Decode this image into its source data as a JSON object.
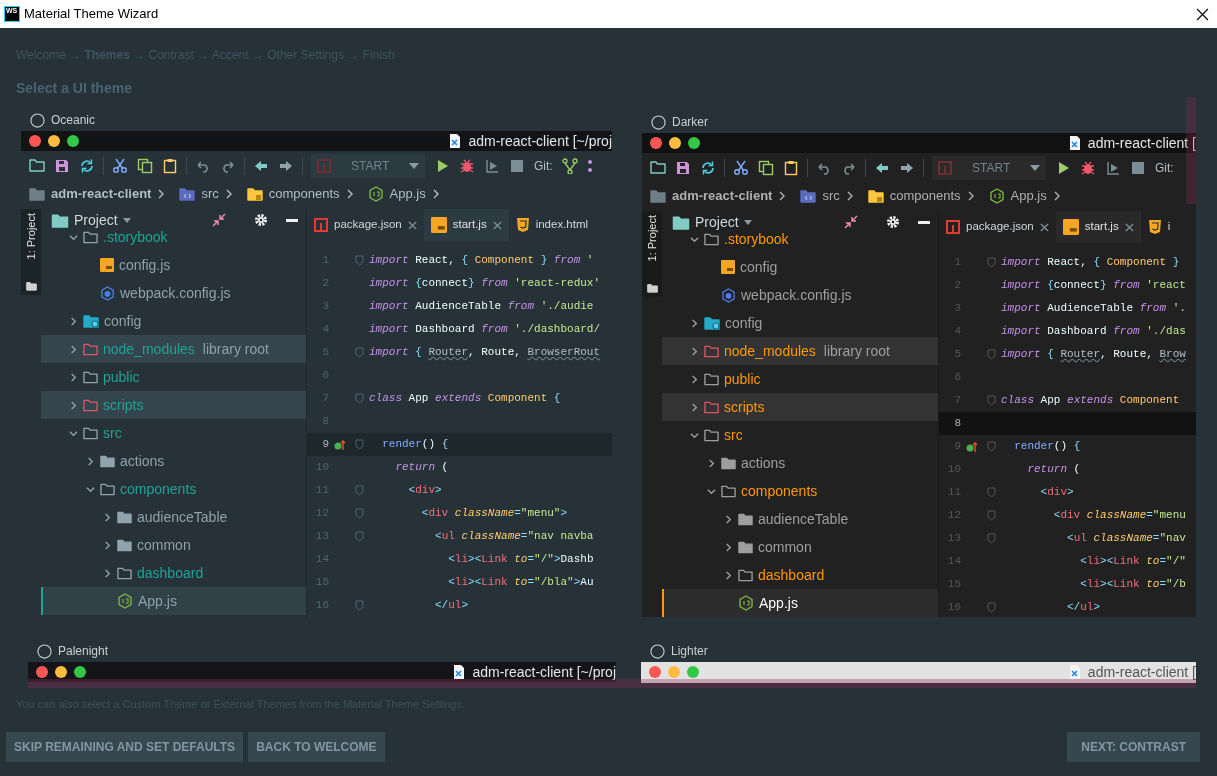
{
  "window": {
    "app_icon_text": "WS",
    "title": "Material Theme Wizard"
  },
  "steps": "Welcome → **Themes** → Contrast → Accent → Other Settings → Finish",
  "heading": "Select a UI theme",
  "themes": [
    {
      "name": "Oceanic",
      "selected": false,
      "kind": "oceanic",
      "preview": {
        "title": "adm-react-client [~/proj",
        "run_config": "START",
        "git_label": "Git:",
        "git_icons": true,
        "breadcrumbs": [
          {
            "label": "adm-react-client",
            "kind": "root"
          },
          {
            "label": "src",
            "kind": "source"
          },
          {
            "label": "components",
            "kind": "package"
          },
          {
            "label": "App.js",
            "kind": "node"
          }
        ],
        "side_tab": "1: Project",
        "panel_title": "Project",
        "tree": [
          {
            "label": ".storybook",
            "kind": "folder",
            "expanded": true,
            "accent": true,
            "highlighted": false,
            "selected": false,
            "children": [
              {
                "label": "config.js",
                "kind": "js",
                "accent": false,
                "highlighted": false,
                "selected": false
              },
              {
                "label": "webpack.config.js",
                "kind": "webpack",
                "accent": false,
                "highlighted": false,
                "selected": false
              }
            ]
          },
          {
            "label": "config",
            "kind": "config_folder",
            "expanded": false,
            "accent": false,
            "highlighted": false,
            "selected": false
          },
          {
            "label": "node_modules",
            "note": "library root",
            "kind": "excluded",
            "expanded": false,
            "accent": true,
            "highlighted": true,
            "selected": false
          },
          {
            "label": "public",
            "kind": "folder",
            "expanded": false,
            "accent": true,
            "highlighted": false,
            "selected": false
          },
          {
            "label": "scripts",
            "kind": "excluded",
            "expanded": false,
            "accent": true,
            "highlighted": true,
            "selected": false
          },
          {
            "label": "src",
            "kind": "folder",
            "expanded": true,
            "accent": true,
            "highlighted": false,
            "selected": false,
            "children": [
              {
                "label": "actions",
                "kind": "filled_folder",
                "expanded": false,
                "accent": false,
                "highlighted": false,
                "selected": false
              },
              {
                "label": "components",
                "kind": "folder",
                "expanded": true,
                "accent": true,
                "highlighted": false,
                "selected": false,
                "children": [
                  {
                    "label": "audienceTable",
                    "kind": "filled_folder",
                    "expanded": false,
                    "accent": false,
                    "highlighted": false,
                    "selected": false
                  },
                  {
                    "label": "common",
                    "kind": "filled_folder",
                    "expanded": false,
                    "accent": false,
                    "highlighted": false,
                    "selected": false
                  },
                  {
                    "label": "dashboard",
                    "kind": "folder",
                    "expanded": false,
                    "accent": true,
                    "highlighted": false,
                    "selected": false
                  },
                  {
                    "label": "App.js",
                    "kind": "node",
                    "accent": false,
                    "highlighted": false,
                    "selected": true
                  }
                ]
              }
            ]
          }
        ],
        "tabs": [
          {
            "label": "package.json",
            "kind": "npm",
            "selected": false,
            "closable": true
          },
          {
            "label": "start.js",
            "kind": "js",
            "selected": true,
            "closable": true
          },
          {
            "label": "index.html",
            "kind": "html",
            "selected": false,
            "closable": false
          }
        ],
        "code": [
          {
            "n": "1",
            "current": false,
            "mark": false,
            "fold": true,
            "code": [
              {
                "kind": "keyword",
                "text": "import"
              },
              {
                "text": " React, "
              },
              {
                "kind": "punct",
                "text": "{ "
              },
              {
                "kind": "class",
                "text": "Component"
              },
              {
                "kind": "punct",
                "text": " } "
              },
              {
                "kind": "keyword",
                "text": "from"
              },
              {
                "kind": "string",
                "text": " '"
              }
            ]
          },
          {
            "n": "2",
            "current": false,
            "mark": false,
            "fold": false,
            "code": [
              {
                "kind": "keyword",
                "text": "import"
              },
              {
                "kind": "punct",
                "text": " {"
              },
              {
                "text": "connect"
              },
              {
                "kind": "punct",
                "text": "} "
              },
              {
                "kind": "keyword",
                "text": "from"
              },
              {
                "kind": "string",
                "text": " 'react-redux'"
              }
            ]
          },
          {
            "n": "3",
            "current": false,
            "mark": false,
            "fold": false,
            "code": [
              {
                "kind": "keyword",
                "text": "import"
              },
              {
                "text": " AudienceTable "
              },
              {
                "kind": "keyword",
                "text": "from"
              },
              {
                "kind": "string",
                "text": " './audie"
              }
            ]
          },
          {
            "n": "4",
            "current": false,
            "mark": false,
            "fold": false,
            "code": [
              {
                "kind": "keyword",
                "text": "import"
              },
              {
                "text": " Dashboard "
              },
              {
                "kind": "keyword",
                "text": "from"
              },
              {
                "kind": "string",
                "text": " './dashboard/"
              }
            ]
          },
          {
            "n": "5",
            "current": false,
            "mark": false,
            "fold": true,
            "code": [
              {
                "kind": "keyword",
                "text": "import"
              },
              {
                "kind": "punct",
                "text": " { "
              },
              {
                "kind": "warning",
                "text": "Router"
              },
              {
                "text": ", Route, "
              },
              {
                "kind": "warning",
                "text": "BrowserRout"
              }
            ]
          },
          {
            "n": "6",
            "current": false,
            "mark": false,
            "fold": false
          },
          {
            "n": "7",
            "current": false,
            "mark": false,
            "fold": true,
            "code": [
              {
                "kind": "keyword",
                "text": "class"
              },
              {
                "text": " App "
              },
              {
                "kind": "keyword",
                "text": "extends"
              },
              {
                "kind": "class",
                "text": " Component"
              },
              {
                "kind": "punct",
                "text": " {"
              }
            ]
          },
          {
            "n": "8",
            "current": false,
            "mark": false,
            "fold": false
          },
          {
            "n": "9",
            "current": true,
            "mark": true,
            "fold": true,
            "code": [
              {
                "kind": "function",
                "text": "  render"
              },
              {
                "text": "() "
              },
              {
                "kind": "punct",
                "text": "{"
              }
            ]
          },
          {
            "n": "10",
            "current": false,
            "mark": false,
            "fold": false,
            "code": [
              {
                "kind": "keyword",
                "text": "    return"
              },
              {
                "text": " ("
              }
            ]
          },
          {
            "n": "11",
            "current": false,
            "mark": false,
            "fold": true,
            "code": [
              {
                "kind": "punct",
                "text": "      <"
              },
              {
                "kind": "tag",
                "text": "div"
              },
              {
                "kind": "punct",
                "text": ">"
              }
            ]
          },
          {
            "n": "12",
            "current": false,
            "mark": false,
            "fold": true,
            "code": [
              {
                "kind": "punct",
                "text": "        <"
              },
              {
                "kind": "tag",
                "text": "div"
              },
              {
                "kind": "attribute",
                "text": " className"
              },
              {
                "kind": "punct",
                "text": "="
              },
              {
                "kind": "string",
                "text": "\"menu\""
              },
              {
                "kind": "punct",
                "text": ">"
              }
            ]
          },
          {
            "n": "13",
            "current": false,
            "mark": false,
            "fold": true,
            "code": [
              {
                "kind": "punct",
                "text": "          <"
              },
              {
                "kind": "tag",
                "text": "ul"
              },
              {
                "kind": "attribute",
                "text": " className"
              },
              {
                "kind": "punct",
                "text": "="
              },
              {
                "kind": "string",
                "text": "\"nav navba"
              }
            ]
          },
          {
            "n": "14",
            "current": false,
            "mark": false,
            "fold": false,
            "code": [
              {
                "kind": "punct",
                "text": "            <"
              },
              {
                "kind": "tag",
                "text": "li"
              },
              {
                "kind": "punct",
                "text": "><"
              },
              {
                "kind": "tag",
                "text": "Link"
              },
              {
                "kind": "attribute",
                "text": " to"
              },
              {
                "kind": "punct",
                "text": "="
              },
              {
                "kind": "string",
                "text": "\"/\""
              },
              {
                "kind": "punct",
                "text": ">"
              },
              {
                "text": "Dashb"
              }
            ]
          },
          {
            "n": "15",
            "current": false,
            "mark": false,
            "fold": false,
            "code": [
              {
                "kind": "punct",
                "text": "            <"
              },
              {
                "kind": "tag",
                "text": "li"
              },
              {
                "kind": "punct",
                "text": "><"
              },
              {
                "kind": "tag",
                "text": "Link"
              },
              {
                "kind": "attribute",
                "text": " to"
              },
              {
                "kind": "punct",
                "text": "="
              },
              {
                "kind": "string",
                "text": "\"/bla\""
              },
              {
                "kind": "punct",
                "text": ">"
              },
              {
                "text": "Au"
              }
            ]
          },
          {
            "n": "16",
            "current": false,
            "mark": false,
            "fold": true,
            "code": [
              {
                "kind": "punct",
                "text": "          </"
              },
              {
                "kind": "tag",
                "text": "ul"
              },
              {
                "kind": "punct",
                "text": ">"
              }
            ]
          }
        ]
      }
    },
    {
      "name": "Darker",
      "selected": false,
      "kind": "darker",
      "preview": {
        "title": "adm-react-client [",
        "run_config": "START",
        "git_label": "Git:",
        "git_icons": false,
        "breadcrumbs": [
          {
            "label": "adm-react-client",
            "kind": "root"
          },
          {
            "label": "src",
            "kind": "source"
          },
          {
            "label": "components",
            "kind": "package"
          },
          {
            "label": "App.js",
            "kind": "node"
          }
        ],
        "side_tab": "1: Project",
        "panel_title": "Project",
        "tree": [
          {
            "label": ".storybook",
            "kind": "folder",
            "expanded": true,
            "accent": true,
            "highlighted": false,
            "selected": false,
            "children": [
              {
                "label": "config",
                "kind": "js",
                "accent": false,
                "highlighted": false,
                "selected": false
              },
              {
                "label": "webpack.config.js",
                "kind": "webpack",
                "accent": false,
                "highlighted": false,
                "selected": false
              }
            ]
          },
          {
            "label": "config",
            "kind": "config_folder",
            "expanded": false,
            "accent": false,
            "highlighted": false,
            "selected": false
          },
          {
            "label": "node_modules",
            "note": "library root",
            "kind": "excluded",
            "expanded": false,
            "accent": true,
            "highlighted": true,
            "selected": false
          },
          {
            "label": "public",
            "kind": "folder",
            "expanded": false,
            "accent": true,
            "highlighted": false,
            "selected": false
          },
          {
            "label": "scripts",
            "kind": "excluded",
            "expanded": false,
            "accent": true,
            "highlighted": true,
            "selected": false
          },
          {
            "label": "src",
            "kind": "folder",
            "expanded": true,
            "accent": true,
            "highlighted": false,
            "selected": false,
            "children": [
              {
                "label": "actions",
                "kind": "filled_folder",
                "expanded": false,
                "accent": false,
                "highlighted": false,
                "selected": false
              },
              {
                "label": "components",
                "kind": "folder",
                "expanded": true,
                "accent": true,
                "highlighted": false,
                "selected": false,
                "children": [
                  {
                    "label": "audienceTable",
                    "kind": "filled_folder",
                    "expanded": false,
                    "accent": false,
                    "highlighted": false,
                    "selected": false
                  },
                  {
                    "label": "common",
                    "kind": "filled_folder",
                    "expanded": false,
                    "accent": false,
                    "highlighted": false,
                    "selected": false
                  },
                  {
                    "label": "dashboard",
                    "kind": "folder",
                    "expanded": false,
                    "accent": true,
                    "highlighted": false,
                    "selected": false
                  },
                  {
                    "label": "App.js",
                    "kind": "node",
                    "accent": false,
                    "highlighted": false,
                    "selected": true
                  }
                ]
              }
            ]
          }
        ],
        "tabs": [
          {
            "label": "package.json",
            "kind": "npm",
            "selected": false,
            "closable": true
          },
          {
            "label": "start.js",
            "kind": "js",
            "selected": true,
            "closable": true
          },
          {
            "label": "i",
            "kind": "html",
            "selected": false,
            "closable": false
          }
        ],
        "code": [
          {
            "n": "1",
            "current": false,
            "mark": false,
            "fold": true,
            "code": [
              {
                "kind": "keyword",
                "text": "import"
              },
              {
                "text": " React, "
              },
              {
                "kind": "punct",
                "text": "{ "
              },
              {
                "kind": "class",
                "text": "Component"
              },
              {
                "kind": "punct",
                "text": " }"
              }
            ]
          },
          {
            "n": "2",
            "current": false,
            "mark": false,
            "fold": false,
            "code": [
              {
                "kind": "keyword",
                "text": "import"
              },
              {
                "kind": "punct",
                "text": " {"
              },
              {
                "text": "connect"
              },
              {
                "kind": "punct",
                "text": "} "
              },
              {
                "kind": "keyword",
                "text": "from"
              },
              {
                "kind": "string",
                "text": " 'react"
              }
            ]
          },
          {
            "n": "3",
            "current": false,
            "mark": false,
            "fold": false,
            "code": [
              {
                "kind": "keyword",
                "text": "import"
              },
              {
                "text": " AudienceTable "
              },
              {
                "kind": "keyword",
                "text": "from"
              },
              {
                "kind": "string",
                "text": " '."
              }
            ]
          },
          {
            "n": "4",
            "current": false,
            "mark": false,
            "fold": false,
            "code": [
              {
                "kind": "keyword",
                "text": "import"
              },
              {
                "text": " Dashboard "
              },
              {
                "kind": "keyword",
                "text": "from"
              },
              {
                "kind": "string",
                "text": " './das"
              }
            ]
          },
          {
            "n": "5",
            "current": false,
            "mark": false,
            "fold": true,
            "code": [
              {
                "kind": "keyword",
                "text": "import"
              },
              {
                "kind": "punct",
                "text": " { "
              },
              {
                "kind": "warning",
                "text": "Router"
              },
              {
                "text": ", Route, "
              },
              {
                "kind": "warning",
                "text": "Brow"
              }
            ]
          },
          {
            "n": "6",
            "current": false,
            "mark": false,
            "fold": false
          },
          {
            "n": "7",
            "current": false,
            "mark": false,
            "fold": true,
            "code": [
              {
                "kind": "keyword",
                "text": "class"
              },
              {
                "text": " App "
              },
              {
                "kind": "keyword",
                "text": "extends"
              },
              {
                "kind": "class",
                "text": " Component"
              }
            ]
          },
          {
            "n": "8",
            "current": true,
            "mark": false,
            "fold": false
          },
          {
            "n": "9",
            "current": false,
            "mark": true,
            "fold": true,
            "code": [
              {
                "kind": "function",
                "text": "  render"
              },
              {
                "text": "() "
              },
              {
                "kind": "punct",
                "text": "{"
              }
            ]
          },
          {
            "n": "10",
            "current": false,
            "mark": false,
            "fold": false,
            "code": [
              {
                "kind": "keyword",
                "text": "    return"
              },
              {
                "text": " ("
              }
            ]
          },
          {
            "n": "11",
            "current": false,
            "mark": false,
            "fold": true,
            "code": [
              {
                "kind": "punct",
                "text": "      <"
              },
              {
                "kind": "tag",
                "text": "div"
              },
              {
                "kind": "punct",
                "text": ">"
              }
            ]
          },
          {
            "n": "12",
            "current": false,
            "mark": false,
            "fold": true,
            "code": [
              {
                "kind": "punct",
                "text": "        <"
              },
              {
                "kind": "tag",
                "text": "div"
              },
              {
                "kind": "attribute",
                "text": " className"
              },
              {
                "kind": "punct",
                "text": "="
              },
              {
                "kind": "string",
                "text": "\"menu"
              }
            ]
          },
          {
            "n": "13",
            "current": false,
            "mark": false,
            "fold": true,
            "code": [
              {
                "kind": "punct",
                "text": "          <"
              },
              {
                "kind": "tag",
                "text": "ul"
              },
              {
                "kind": "attribute",
                "text": " className"
              },
              {
                "kind": "punct",
                "text": "="
              },
              {
                "kind": "string",
                "text": "\"nav"
              }
            ]
          },
          {
            "n": "14",
            "current": false,
            "mark": false,
            "fold": false,
            "code": [
              {
                "kind": "punct",
                "text": "            <"
              },
              {
                "kind": "tag",
                "text": "li"
              },
              {
                "kind": "punct",
                "text": "><"
              },
              {
                "kind": "tag",
                "text": "Link"
              },
              {
                "kind": "attribute",
                "text": " to"
              },
              {
                "kind": "punct",
                "text": "="
              },
              {
                "kind": "string",
                "text": "\"/\""
              }
            ]
          },
          {
            "n": "15",
            "current": false,
            "mark": false,
            "fold": false,
            "code": [
              {
                "kind": "punct",
                "text": "            <"
              },
              {
                "kind": "tag",
                "text": "li"
              },
              {
                "kind": "punct",
                "text": "><"
              },
              {
                "kind": "tag",
                "text": "Link"
              },
              {
                "kind": "attribute",
                "text": " to"
              },
              {
                "kind": "punct",
                "text": "="
              },
              {
                "kind": "string",
                "text": "\"/b"
              }
            ]
          },
          {
            "n": "16",
            "current": false,
            "mark": false,
            "fold": true,
            "code": [
              {
                "kind": "punct",
                "text": "          </"
              },
              {
                "kind": "tag",
                "text": "ul"
              },
              {
                "kind": "punct",
                "text": ">"
              }
            ]
          }
        ]
      }
    },
    {
      "name": "Palenight",
      "selected": false,
      "kind": "palenight",
      "preview": {
        "title": "adm-react-client [~/proj"
      }
    },
    {
      "name": "Lighter",
      "selected": false,
      "kind": "lighter",
      "preview": {
        "title": "adm-react-client ["
      }
    }
  ],
  "note": "You can also select a Custom Theme or External Themes from the Material Theme Settings.",
  "buttons_left": [
    "SKIP REMAINING AND SET DEFAULTS",
    "BACK TO WELCOME"
  ],
  "buttons_right": [
    "NEXT: CONTRAST"
  ]
}
